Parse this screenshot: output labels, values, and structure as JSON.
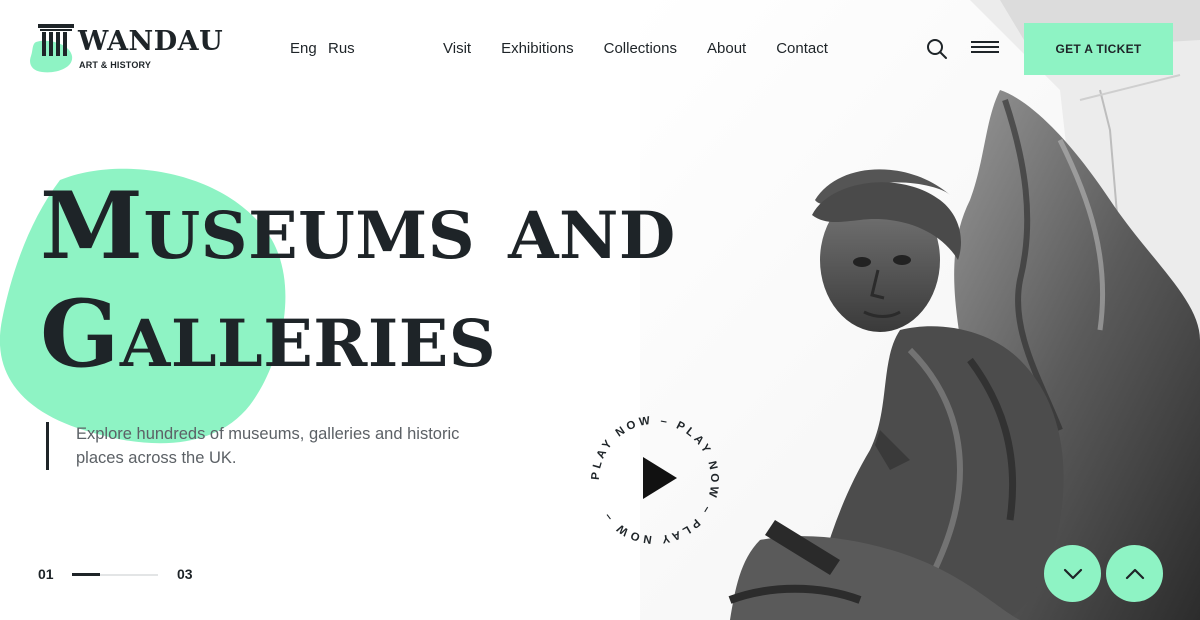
{
  "brand": {
    "name": "WANDAU",
    "tagline": "ART & HISTORY"
  },
  "languages": [
    "Eng",
    "Rus"
  ],
  "nav": [
    "Visit",
    "Exhibitions",
    "Collections",
    "About",
    "Contact"
  ],
  "header": {
    "ticket_label": "GET A TICKET"
  },
  "hero": {
    "title_line1": "Museums and",
    "title_line2": "Galleries",
    "intro": "Explore hundreds of museums, galleries and historic places across the UK."
  },
  "slider": {
    "current": "01",
    "total": "03",
    "progress": 0.33
  },
  "play": {
    "ring_text": "PLAY NOW – PLAY NOW – PLAY NOW – "
  },
  "icons": {
    "logo": "greek-column-icon",
    "search": "search-icon",
    "menu": "hamburger-menu-icon",
    "play": "play-icon",
    "scroll_down": "chevron-down-icon",
    "scroll_up": "chevron-up-icon"
  },
  "colors": {
    "accent": "#8ef3c4",
    "text": "#1e2428",
    "muted_text": "#5c6166"
  }
}
